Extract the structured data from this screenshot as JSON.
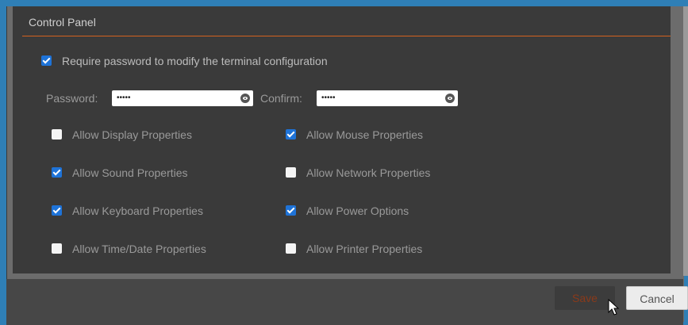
{
  "window": {
    "title": "Control Panel"
  },
  "require_password": {
    "label": "Require password to modify the terminal configuration",
    "checked": true
  },
  "password": {
    "label": "Password:",
    "value": "•••••"
  },
  "confirm": {
    "label": "Confirm:",
    "value": "•••••"
  },
  "options": [
    {
      "label": "Allow Display Properties",
      "checked": false
    },
    {
      "label": "Allow Mouse Properties",
      "checked": true
    },
    {
      "label": "Allow Sound Properties",
      "checked": true
    },
    {
      "label": "Allow Network Properties",
      "checked": false
    },
    {
      "label": "Allow Keyboard Properties",
      "checked": true
    },
    {
      "label": "Allow Power Options",
      "checked": true
    },
    {
      "label": "Allow Time/Date Properties",
      "checked": false
    },
    {
      "label": "Allow Printer Properties",
      "checked": false
    }
  ],
  "footer": {
    "save_label": "Save",
    "cancel_label": "Cancel"
  },
  "colors": {
    "accent": "#d4621e",
    "checkbox": "#1e73d8",
    "background": "#3a3a3a"
  },
  "icons": {
    "reveal": "eye-icon",
    "pointer": "mouse-cursor-icon"
  }
}
